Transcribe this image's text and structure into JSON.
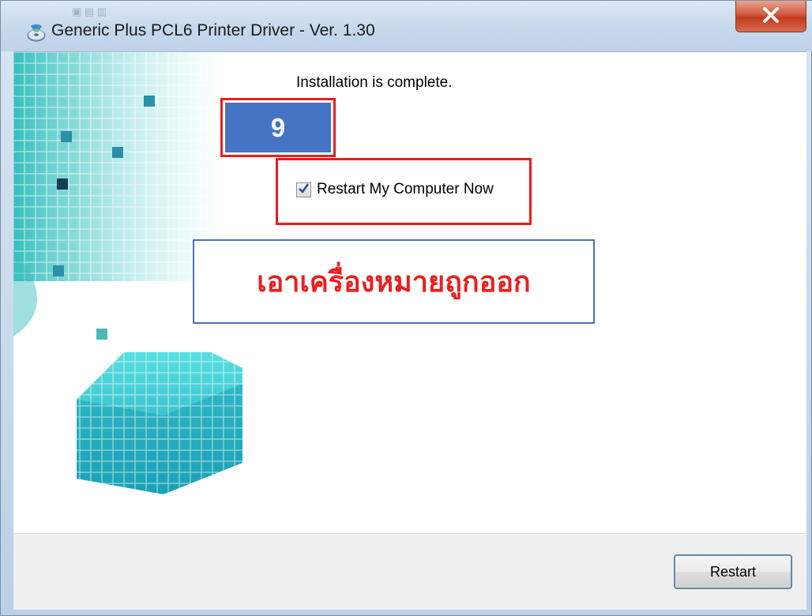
{
  "window": {
    "title": "Generic Plus PCL6 Printer Driver - Ver. 1.30"
  },
  "content": {
    "message": "Installation is complete.",
    "restart_checkbox": {
      "label": "Restart My Computer Now",
      "checked": true
    }
  },
  "footer": {
    "restart_label": "Restart"
  },
  "annotations": {
    "step_number": "9",
    "note": "เอาเครื่องหมายถูกออก"
  },
  "colors": {
    "annotation_red": "#ee1c1c",
    "step_blue": "#4674c4",
    "note_border": "#4a74b4",
    "art_teal": "#2fc9c9"
  },
  "icons": {
    "app": "installer-disc-icon",
    "close": "close-icon",
    "check": "checkmark-icon"
  }
}
